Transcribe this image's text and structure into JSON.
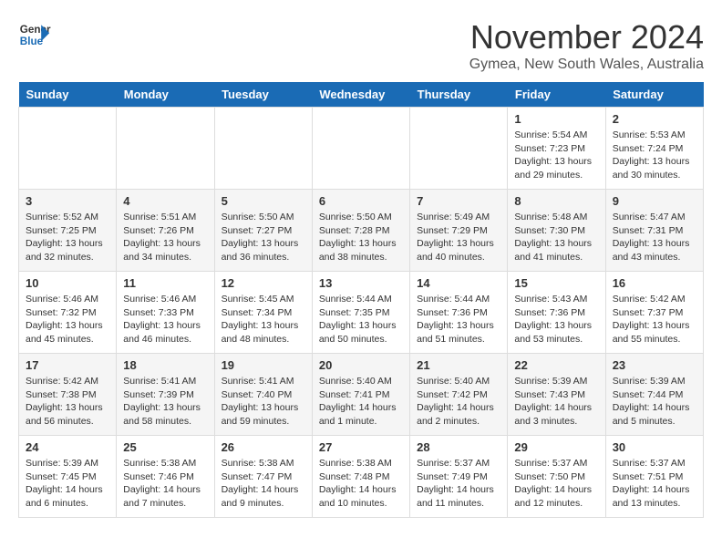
{
  "logo": {
    "line1": "General",
    "line2": "Blue"
  },
  "title": "November 2024",
  "location": "Gymea, New South Wales, Australia",
  "headers": [
    "Sunday",
    "Monday",
    "Tuesday",
    "Wednesday",
    "Thursday",
    "Friday",
    "Saturday"
  ],
  "weeks": [
    [
      {
        "day": "",
        "info": ""
      },
      {
        "day": "",
        "info": ""
      },
      {
        "day": "",
        "info": ""
      },
      {
        "day": "",
        "info": ""
      },
      {
        "day": "",
        "info": ""
      },
      {
        "day": "1",
        "info": "Sunrise: 5:54 AM\nSunset: 7:23 PM\nDaylight: 13 hours\nand 29 minutes."
      },
      {
        "day": "2",
        "info": "Sunrise: 5:53 AM\nSunset: 7:24 PM\nDaylight: 13 hours\nand 30 minutes."
      }
    ],
    [
      {
        "day": "3",
        "info": "Sunrise: 5:52 AM\nSunset: 7:25 PM\nDaylight: 13 hours\nand 32 minutes."
      },
      {
        "day": "4",
        "info": "Sunrise: 5:51 AM\nSunset: 7:26 PM\nDaylight: 13 hours\nand 34 minutes."
      },
      {
        "day": "5",
        "info": "Sunrise: 5:50 AM\nSunset: 7:27 PM\nDaylight: 13 hours\nand 36 minutes."
      },
      {
        "day": "6",
        "info": "Sunrise: 5:50 AM\nSunset: 7:28 PM\nDaylight: 13 hours\nand 38 minutes."
      },
      {
        "day": "7",
        "info": "Sunrise: 5:49 AM\nSunset: 7:29 PM\nDaylight: 13 hours\nand 40 minutes."
      },
      {
        "day": "8",
        "info": "Sunrise: 5:48 AM\nSunset: 7:30 PM\nDaylight: 13 hours\nand 41 minutes."
      },
      {
        "day": "9",
        "info": "Sunrise: 5:47 AM\nSunset: 7:31 PM\nDaylight: 13 hours\nand 43 minutes."
      }
    ],
    [
      {
        "day": "10",
        "info": "Sunrise: 5:46 AM\nSunset: 7:32 PM\nDaylight: 13 hours\nand 45 minutes."
      },
      {
        "day": "11",
        "info": "Sunrise: 5:46 AM\nSunset: 7:33 PM\nDaylight: 13 hours\nand 46 minutes."
      },
      {
        "day": "12",
        "info": "Sunrise: 5:45 AM\nSunset: 7:34 PM\nDaylight: 13 hours\nand 48 minutes."
      },
      {
        "day": "13",
        "info": "Sunrise: 5:44 AM\nSunset: 7:35 PM\nDaylight: 13 hours\nand 50 minutes."
      },
      {
        "day": "14",
        "info": "Sunrise: 5:44 AM\nSunset: 7:36 PM\nDaylight: 13 hours\nand 51 minutes."
      },
      {
        "day": "15",
        "info": "Sunrise: 5:43 AM\nSunset: 7:36 PM\nDaylight: 13 hours\nand 53 minutes."
      },
      {
        "day": "16",
        "info": "Sunrise: 5:42 AM\nSunset: 7:37 PM\nDaylight: 13 hours\nand 55 minutes."
      }
    ],
    [
      {
        "day": "17",
        "info": "Sunrise: 5:42 AM\nSunset: 7:38 PM\nDaylight: 13 hours\nand 56 minutes."
      },
      {
        "day": "18",
        "info": "Sunrise: 5:41 AM\nSunset: 7:39 PM\nDaylight: 13 hours\nand 58 minutes."
      },
      {
        "day": "19",
        "info": "Sunrise: 5:41 AM\nSunset: 7:40 PM\nDaylight: 13 hours\nand 59 minutes."
      },
      {
        "day": "20",
        "info": "Sunrise: 5:40 AM\nSunset: 7:41 PM\nDaylight: 14 hours\nand 1 minute."
      },
      {
        "day": "21",
        "info": "Sunrise: 5:40 AM\nSunset: 7:42 PM\nDaylight: 14 hours\nand 2 minutes."
      },
      {
        "day": "22",
        "info": "Sunrise: 5:39 AM\nSunset: 7:43 PM\nDaylight: 14 hours\nand 3 minutes."
      },
      {
        "day": "23",
        "info": "Sunrise: 5:39 AM\nSunset: 7:44 PM\nDaylight: 14 hours\nand 5 minutes."
      }
    ],
    [
      {
        "day": "24",
        "info": "Sunrise: 5:39 AM\nSunset: 7:45 PM\nDaylight: 14 hours\nand 6 minutes."
      },
      {
        "day": "25",
        "info": "Sunrise: 5:38 AM\nSunset: 7:46 PM\nDaylight: 14 hours\nand 7 minutes."
      },
      {
        "day": "26",
        "info": "Sunrise: 5:38 AM\nSunset: 7:47 PM\nDaylight: 14 hours\nand 9 minutes."
      },
      {
        "day": "27",
        "info": "Sunrise: 5:38 AM\nSunset: 7:48 PM\nDaylight: 14 hours\nand 10 minutes."
      },
      {
        "day": "28",
        "info": "Sunrise: 5:37 AM\nSunset: 7:49 PM\nDaylight: 14 hours\nand 11 minutes."
      },
      {
        "day": "29",
        "info": "Sunrise: 5:37 AM\nSunset: 7:50 PM\nDaylight: 14 hours\nand 12 minutes."
      },
      {
        "day": "30",
        "info": "Sunrise: 5:37 AM\nSunset: 7:51 PM\nDaylight: 14 hours\nand 13 minutes."
      }
    ]
  ]
}
